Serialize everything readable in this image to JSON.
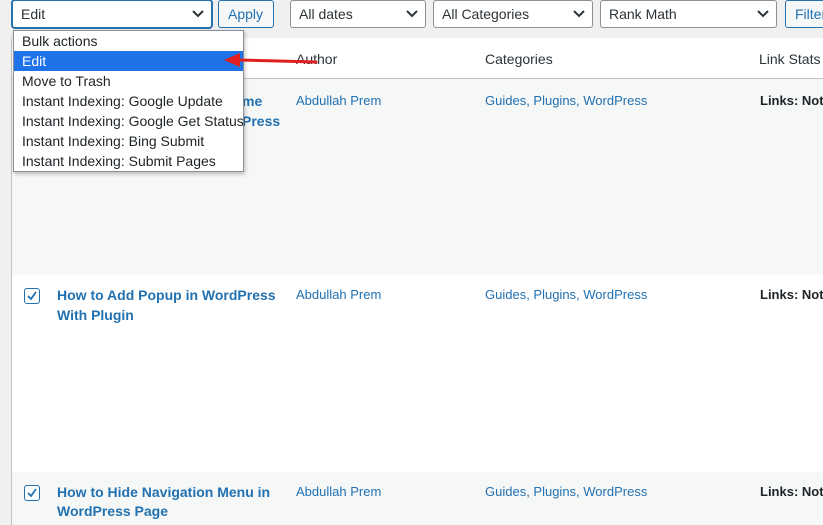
{
  "toolbar": {
    "bulk_select_value": "Edit",
    "apply_label": "Apply",
    "dates_value": "All dates",
    "categories_value": "All Categories",
    "rankmath_value": "Rank Math",
    "filter_label": "Filter"
  },
  "dropdown": {
    "options": [
      "Bulk actions",
      "Edit",
      "Move to Trash",
      "Instant Indexing: Google Update",
      "Instant Indexing: Google Get Status",
      "Instant Indexing: Bing Submit",
      "Instant Indexing: Submit Pages"
    ],
    "selected": "Edit"
  },
  "table": {
    "headers": {
      "author": "Author",
      "categories": "Categories",
      "link_stats": "Link Stats"
    },
    "rows": [
      {
        "title_partial_1": "me",
        "title_partial_2": "Press",
        "author": "Abdullah Prem",
        "categories": "Guides, Plugins, WordPress",
        "links": "Links: Not S"
      },
      {
        "title_line1": "How to Add Popup in WordPress",
        "title_line2": "With Plugin",
        "author": "Abdullah Prem",
        "categories": "Guides, Plugins, WordPress",
        "links": "Links: Not S",
        "checked": true
      },
      {
        "title_line1": "How to Hide Navigation Menu in",
        "title_line2": "WordPress Page",
        "author": "Abdullah Prem",
        "categories": "Guides, Plugins, WordPress",
        "links": "Links: Not S",
        "checked": true
      }
    ]
  },
  "colors": {
    "accent": "#2271b1",
    "selected_option": "#1e73e8",
    "arrow": "#e02020"
  }
}
